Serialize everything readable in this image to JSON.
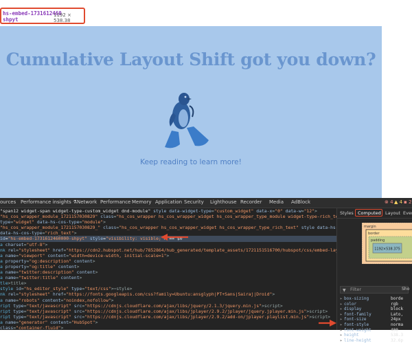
{
  "tooltip": {
    "element_id": "hs-embed-1731612460",
    "sub": "shpyt",
    "dims": "1192 × 538.38"
  },
  "hero": {
    "title": "Cumulative Layout Shift got you down?",
    "subtitle": "Keep reading to learn more!"
  },
  "devtools": {
    "tabs": [
      "ources",
      "Performance insights ⚗",
      "Network",
      "Performance",
      "Memory",
      "Application",
      "Security",
      "Lighthouse",
      "Recorder",
      "Media",
      "AdBlock"
    ],
    "counts": {
      "errors": "⊗ 4",
      "warnings": "▲ 4",
      "issues": "▪ 2"
    },
    "dom_lines": [
      {
        "html": "<span class='txt'>\"span12 widget-span widget-type-custom_widget dnd-module\"</span> <span class='att'>style data-widget-type</span>=<span class='val'>\"custom_widget\"</span> <span class='att'>data-x</span>=<span class='val'>\"0\"</span> <span class='att'>data-w</span>=<span class='val'>\"12\"</span>>"
      },
      {
        "html": "<span class='val'>\"hs_cos_wrapper_module_1721157030829\"</span> <span class='att'>class</span>=<span class='val'>\"hs_cos_wrapper hs_cos_wrapper_widget hs_cos_wrapper_type_module widget-type-rich_text\"</span> <span class='att'>style data-hs-cos-</span>"
      },
      {
        "html": "<span class='att'>type</span>=<span class='val'>\"widget\"</span> <span class='att'>data-hs-cos-type</span>=<span class='val'>\"module\"</span>>"
      },
      {
        "html": "  <span class='val'>\"hs_cos_wrapper_module_1721157030829_\"</span> <span class='att'>class</span>=<span class='val'>\"hs_cos_wrapper hs_cos_wrapper_widget hs_cos_wrapper_type_rich_text\"</span> <span class='att'>style data-hs-cos-general-type</span>=<span class='val'>\"wid</span>"
      },
      {
        "html": "<span class='att'>data-hs-cos-type</span>=<span class='val'>\"rich_text\"</span>>"
      },
      {
        "html": "<span class='att'>id</span>=<span class='val'>\"hs-embed-1731612460000-shpyt\"</span> <span class='att'>style</span>=<span class='val'>\"visibility: visible;\"</span>> == $0",
        "sel": true
      },
      {
        "html": "<span class='tag'>a</span> <span class='att'>charset</span>=<span class='val'>\"utf-8\"</span>>"
      },
      {
        "html": "<span class='tag'>nk</span> <span class='att'>rel</span>=<span class='val'>\"stylesheet\"</span> <span class='att'>href</span>=<span class='val'>\"https://cdn2.hubspot.net/hub/7852864/hub_generated/template_assets/1721151516700/hubspot/css/embed-layout.min.css\"</span>>"
      },
      {
        "html": "<span class='tag'>a</span> <span class='att'>name</span>=<span class='val'>\"viewport\"</span> <span class='att'>content</span>=<span class='val'>\"width=device-width, initial-scale=1\"</span>>"
      },
      {
        "html": "<span class='tag'>a</span> <span class='att'>property</span>=<span class='val'>\"og:description\"</span> <span class='att'>content</span>>"
      },
      {
        "html": "<span class='tag'>a</span> <span class='att'>property</span>=<span class='val'>\"og:title\"</span> <span class='att'>content</span>>"
      },
      {
        "html": "<span class='tag'>a</span> <span class='att'>name</span>=<span class='val'>\"twitter:description\"</span> <span class='att'>content</span>>"
      },
      {
        "html": "<span class='tag'>a</span> <span class='att'>name</span>=<span class='val'>\"twitter:title\"</span> <span class='att'>content</span>>"
      },
      {
        "html": "<span class='tag'>tle</span>></<span class='tag'>title</span>>"
      },
      {
        "html": "<span class='tag'>style</span> <span class='att'>id</span>=<span class='val'>\"hs_editor_style\"</span> <span class='att'>type</span>=<span class='val'>\"text/css\"</span>>⋯</<span class='tag'>style</span>>"
      },
      {
        "html": "<span class='tag'>nk</span> <span class='att'>rel</span>=<span class='val'>\"stylesheet\"</span> <span class='att'>href</span>=<span class='val'>\"https://fonts.googleapis.com/css?family=Ubuntu:ansglyph|PT+Sans|Sairaj|Droid\"</span>>"
      },
      {
        "html": "<span class='tag'>a</span> <span class='att'>name</span>=<span class='val'>\"robots\"</span> <span class='att'>content</span>=<span class='val'>\"noindex,nofollow\"</span>>"
      },
      {
        "html": "<span class='tag'>ript</span> <span class='att'>type</span>=<span class='val'>\"text/javascript\"</span> <span class='att'>src</span>=<span class='val'>\"https://cdnjs.cloudflare.com/ajax/libs/jquery/2.1.3/jquery.min.js\"</span>></<span class='tag'>script</span>>"
      },
      {
        "html": "<span class='tag'>ript</span> <span class='att'>type</span>=<span class='val'>\"text/javascript\"</span> <span class='att'>src</span>=<span class='val'>\"https://cdnjs.cloudflare.com/ajax/libs/jplayer/2.9.2/jplayer/jquery.jplayer.min.js\"</span>></<span class='tag'>script</span>>"
      },
      {
        "html": "<span class='tag'>ript</span> <span class='att'>type</span>=<span class='val'>\"text/javascript\"</span> <span class='att'>src</span>=<span class='val'>\"https://cdnjs.cloudflare.com/ajax/libs/jplayer/2.9.2/add-on/jplayer.playlist.min.js\"</span>></<span class='tag'>script</span>>"
      },
      {
        "html": "<span class='tag'>a</span> <span class='att'>name</span>=<span class='val'>\"generator\"</span> <span class='att'>content</span>=<span class='val'>\"HubSpot\"</span>>"
      },
      {
        "html": "<span class='att'>class</span>=<span class='val'>\"container-fluid\"</span>>"
      },
      {
        "html": "  <span class='att'>class</span>=<span class='val'>\"row-fluid-wrapper\"</span>>"
      }
    ],
    "side_tabs": [
      "Styles",
      "Computed",
      "Layout",
      "Even"
    ],
    "boxmodel": {
      "margin": "margin",
      "border": "border",
      "padding": "padding",
      "content": "1192×538.375"
    },
    "filter_placeholder": "Filter",
    "show_all": "Sho",
    "properties": [
      {
        "name": "box-sizing",
        "value": "borde"
      },
      {
        "name": "color",
        "value": "rgb"
      },
      {
        "name": "display",
        "value": "block"
      },
      {
        "name": "font-family",
        "value": "Lato,"
      },
      {
        "name": "font-size",
        "value": "24px"
      },
      {
        "name": "font-style",
        "value": "norma"
      },
      {
        "name": "font-weight",
        "value": "400"
      },
      {
        "name": "height",
        "value": "538.3"
      },
      {
        "name": "line-height",
        "value": "32.6p"
      }
    ]
  }
}
